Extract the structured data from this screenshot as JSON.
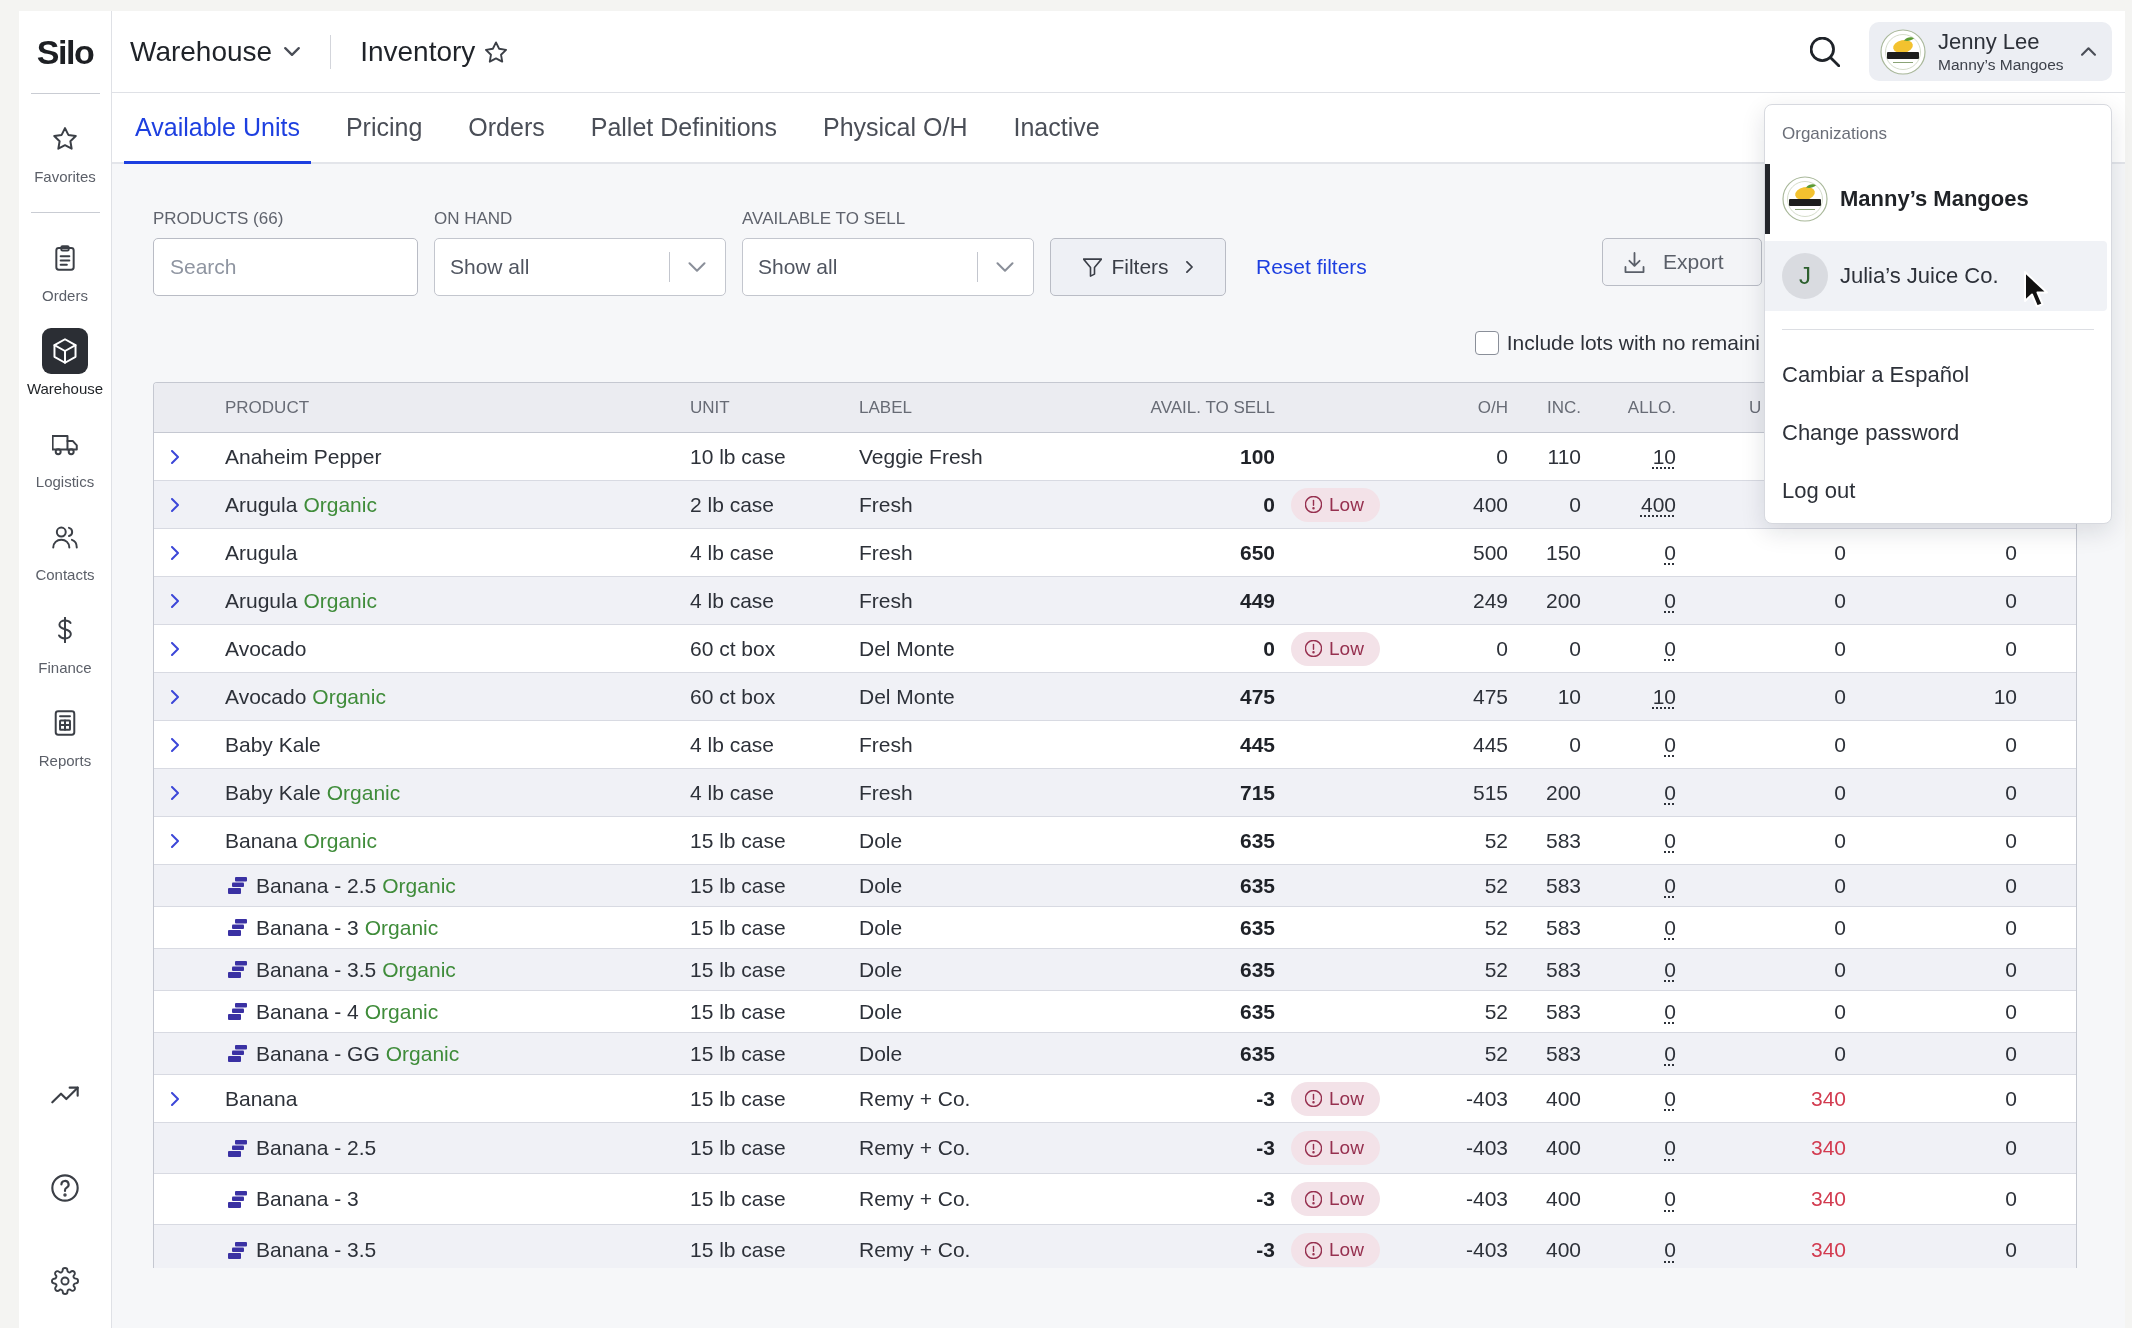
{
  "sidebar": {
    "logo": "Silo",
    "groups": [
      [
        {
          "label": "Favorites",
          "selected": false
        }
      ],
      [
        {
          "label": "Orders",
          "selected": false
        },
        {
          "label": "Warehouse",
          "selected": true
        },
        {
          "label": "Logistics",
          "selected": false
        },
        {
          "label": "Contacts",
          "selected": false
        },
        {
          "label": "Finance",
          "selected": false
        },
        {
          "label": "Reports",
          "selected": false
        }
      ]
    ]
  },
  "header": {
    "module": "Warehouse",
    "page": "Inventory",
    "starred": false,
    "user": {
      "name": "Jenny Lee",
      "organization": "Manny’s Mangoes",
      "expanded": true
    }
  },
  "tabs": [
    {
      "label": "Available Units",
      "selected": true
    },
    {
      "label": "Pricing",
      "selected": false
    },
    {
      "label": "Orders",
      "selected": false
    },
    {
      "label": "Pallet Definitions",
      "selected": false
    },
    {
      "label": "Physical O/H",
      "selected": false
    },
    {
      "label": "Inactive",
      "selected": false
    }
  ],
  "filters": {
    "products": {
      "label": "PRODUCTS (66)",
      "placeholder": "Search"
    },
    "on_hand": {
      "label": "ON HAND",
      "value": "Show all"
    },
    "available_to_sell": {
      "label": "AVAILABLE TO SELL",
      "value": "Show all"
    },
    "filters_button": "Filters",
    "reset_link": "Reset filters",
    "export_button": "Export",
    "include_lots": {
      "label": "Include lots with no remaini",
      "checked": false
    }
  },
  "table": {
    "columns": [
      "PRODUCT",
      "UNIT",
      "LABEL",
      "AVAIL. TO SELL",
      "O/H",
      "INC.",
      "ALLO.",
      "U"
    ],
    "rows": [
      {
        "kind": "product",
        "name": "Anaheim Pepper",
        "unit": "10 lb case",
        "label": "Veggie Fresh",
        "avail": "100",
        "oh": "0",
        "inc": "110",
        "allo": "10"
      },
      {
        "kind": "product",
        "name": "Arugula",
        "tag": "Organic",
        "unit": "2 lb case",
        "label": "Fresh",
        "avail": "0",
        "status": "Low",
        "oh": "400",
        "inc": "0",
        "allo": "400"
      },
      {
        "kind": "product",
        "name": "Arugula",
        "unit": "4 lb case",
        "label": "Fresh",
        "avail": "650",
        "oh": "500",
        "inc": "150",
        "allo": "0",
        "column_10": {
          "text": "0",
          "alert": false
        },
        "column_11": "0"
      },
      {
        "kind": "product",
        "name": "Arugula",
        "tag": "Organic",
        "unit": "4 lb case",
        "label": "Fresh",
        "avail": "449",
        "oh": "249",
        "inc": "200",
        "allo": "0",
        "column_10": {
          "text": "0",
          "alert": false
        },
        "column_11": "0"
      },
      {
        "kind": "product",
        "name": "Avocado",
        "unit": "60 ct box",
        "label": "Del Monte",
        "avail": "0",
        "status": "Low",
        "oh": "0",
        "inc": "0",
        "allo": "0",
        "column_10": {
          "text": "0",
          "alert": false
        },
        "column_11": "0"
      },
      {
        "kind": "product",
        "name": "Avocado",
        "tag": "Organic",
        "unit": "60 ct box",
        "label": "Del Monte",
        "avail": "475",
        "oh": "475",
        "inc": "10",
        "allo": "10",
        "column_10": {
          "text": "0",
          "alert": false
        },
        "column_11": "10"
      },
      {
        "kind": "product",
        "name": "Baby Kale",
        "unit": "4 lb case",
        "label": "Fresh",
        "avail": "445",
        "oh": "445",
        "inc": "0",
        "allo": "0",
        "column_10": {
          "text": "0",
          "alert": false
        },
        "column_11": "0"
      },
      {
        "kind": "product",
        "name": "Baby Kale",
        "tag": "Organic",
        "unit": "4 lb case",
        "label": "Fresh",
        "avail": "715",
        "oh": "515",
        "inc": "200",
        "allo": "0",
        "column_10": {
          "text": "0",
          "alert": false
        },
        "column_11": "0"
      },
      {
        "kind": "product",
        "name": "Banana",
        "tag": "Organic",
        "unit": "15 lb case",
        "label": "Dole",
        "avail": "635",
        "oh": "52",
        "inc": "583",
        "allo": "0",
        "column_10": {
          "text": "0",
          "alert": false
        },
        "column_11": "0"
      },
      {
        "kind": "lot",
        "name": "Banana - 2.5",
        "tag": "Organic",
        "unit": "15 lb case",
        "label": "Dole",
        "avail": "635",
        "oh": "52",
        "inc": "583",
        "allo": "0",
        "column_10": {
          "text": "0",
          "alert": false
        },
        "column_11": "0"
      },
      {
        "kind": "lot",
        "name": "Banana - 3",
        "tag": "Organic",
        "unit": "15 lb case",
        "label": "Dole",
        "avail": "635",
        "oh": "52",
        "inc": "583",
        "allo": "0",
        "column_10": {
          "text": "0",
          "alert": false
        },
        "column_11": "0"
      },
      {
        "kind": "lot",
        "name": "Banana - 3.5",
        "tag": "Organic",
        "unit": "15 lb case",
        "label": "Dole",
        "avail": "635",
        "oh": "52",
        "inc": "583",
        "allo": "0",
        "column_10": {
          "text": "0",
          "alert": false
        },
        "column_11": "0"
      },
      {
        "kind": "lot",
        "name": "Banana - 4",
        "tag": "Organic",
        "unit": "15 lb case",
        "label": "Dole",
        "avail": "635",
        "oh": "52",
        "inc": "583",
        "allo": "0",
        "column_10": {
          "text": "0",
          "alert": false
        },
        "column_11": "0"
      },
      {
        "kind": "lot",
        "name": "Banana - GG",
        "tag": "Organic",
        "unit": "15 lb case",
        "label": "Dole",
        "avail": "635",
        "oh": "52",
        "inc": "583",
        "allo": "0",
        "column_10": {
          "text": "0",
          "alert": false
        },
        "column_11": "0"
      },
      {
        "kind": "product",
        "name": "Banana",
        "unit": "15 lb case",
        "label": "Remy + Co.",
        "avail": "-3",
        "status": "Low",
        "oh": "-403",
        "inc": "400",
        "allo": "0",
        "column_10": {
          "text": "340",
          "alert": true
        },
        "column_11": "0"
      },
      {
        "kind": "lot",
        "name": "Banana - 2.5",
        "unit": "15 lb case",
        "label": "Remy + Co.",
        "avail": "-3",
        "status": "Low",
        "oh": "-403",
        "inc": "400",
        "allo": "0",
        "column_10": {
          "text": "340",
          "alert": true
        },
        "column_11": "0"
      },
      {
        "kind": "lot",
        "name": "Banana - 3",
        "unit": "15 lb case",
        "label": "Remy + Co.",
        "avail": "-3",
        "status": "Low",
        "oh": "-403",
        "inc": "400",
        "allo": "0",
        "column_10": {
          "text": "340",
          "alert": true
        },
        "column_11": "0"
      },
      {
        "kind": "lot",
        "name": "Banana - 3.5",
        "unit": "15 lb case",
        "label": "Remy + Co.",
        "avail": "-3",
        "status": "Low",
        "oh": "-403",
        "inc": "400",
        "allo": "0",
        "column_10": {
          "text": "340",
          "alert": true
        },
        "column_11": "0"
      }
    ]
  },
  "user_menu": {
    "heading": "Organizations",
    "organizations": [
      {
        "name": "Manny’s Mangoes",
        "kind": "logo",
        "selected": true,
        "highlighted": false
      },
      {
        "name": "Julia’s Juice Co.",
        "kind": "initial",
        "initial": "J",
        "selected": false,
        "highlighted": true
      }
    ],
    "actions": [
      "Cambiar a Español",
      "Change password",
      "Log out"
    ]
  }
}
